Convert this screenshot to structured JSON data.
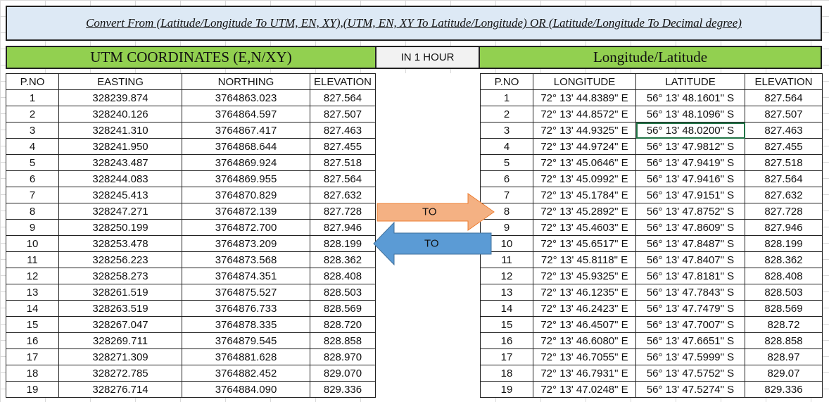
{
  "title": "Convert From (Latitude/Longitude To UTM, EN, XY),(UTM, EN, XY To Latitude/Longitude) OR (Latitude/Longitude To Decimal degree)",
  "utm_header": "UTM COORDINATES (E,N/XY)",
  "middle_label": "IN 1 HOUR",
  "geo_header": "Longitude/Latitude",
  "arrows": {
    "right_label": "TO",
    "left_label": "TO",
    "right_color": "#f4b183",
    "left_color": "#5b9bd5"
  },
  "utm_table": {
    "columns": [
      "P.NO",
      "EASTING",
      "NORTHING",
      "ELEVATION"
    ],
    "rows": [
      [
        "1",
        "328239.874",
        "3764863.023",
        "827.564"
      ],
      [
        "2",
        "328240.126",
        "3764864.597",
        "827.507"
      ],
      [
        "3",
        "328241.310",
        "3764867.417",
        "827.463"
      ],
      [
        "4",
        "328241.950",
        "3764868.644",
        "827.455"
      ],
      [
        "5",
        "328243.487",
        "3764869.924",
        "827.518"
      ],
      [
        "6",
        "328244.083",
        "3764869.955",
        "827.564"
      ],
      [
        "7",
        "328245.413",
        "3764870.829",
        "827.632"
      ],
      [
        "8",
        "328247.271",
        "3764872.139",
        "827.728"
      ],
      [
        "9",
        "328250.199",
        "3764872.700",
        "827.946"
      ],
      [
        "10",
        "328253.478",
        "3764873.209",
        "828.199"
      ],
      [
        "11",
        "328256.223",
        "3764873.568",
        "828.362"
      ],
      [
        "12",
        "328258.273",
        "3764874.351",
        "828.408"
      ],
      [
        "13",
        "328261.519",
        "3764875.527",
        "828.503"
      ],
      [
        "14",
        "328263.519",
        "3764876.733",
        "828.569"
      ],
      [
        "15",
        "328267.047",
        "3764878.335",
        "828.720"
      ],
      [
        "16",
        "328269.711",
        "3764879.545",
        "828.858"
      ],
      [
        "17",
        "328271.309",
        "3764881.628",
        "828.970"
      ],
      [
        "18",
        "328272.785",
        "3764882.452",
        "829.070"
      ],
      [
        "19",
        "328276.714",
        "3764884.090",
        "829.336"
      ]
    ]
  },
  "geo_table": {
    "columns": [
      "P.NO",
      "LONGITUDE",
      "LATITUDE",
      "ELEVATION"
    ],
    "rows": [
      [
        "1",
        "72° 13' 44.8389\" E",
        "56° 13' 48.1601\" S",
        "827.564"
      ],
      [
        "2",
        "72° 13' 44.8572\" E",
        "56° 13' 48.1096\" S",
        "827.507"
      ],
      [
        "3",
        "72° 13' 44.9325\" E",
        "56° 13' 48.0200\" S",
        "827.463"
      ],
      [
        "4",
        "72° 13' 44.9724\" E",
        "56° 13' 47.9812\" S",
        "827.455"
      ],
      [
        "5",
        "72° 13' 45.0646\" E",
        "56° 13' 47.9419\" S",
        "827.518"
      ],
      [
        "6",
        "72° 13' 45.0992\" E",
        "56° 13' 47.9416\" S",
        "827.564"
      ],
      [
        "7",
        "72° 13' 45.1784\" E",
        "56° 13' 47.9151\" S",
        "827.632"
      ],
      [
        "8",
        "72° 13' 45.2892\" E",
        "56° 13' 47.8752\" S",
        "827.728"
      ],
      [
        "9",
        "72° 13' 45.4603\" E",
        "56° 13' 47.8609\" S",
        "827.946"
      ],
      [
        "10",
        "72° 13' 45.6517\" E",
        "56° 13' 47.8487\" S",
        "828.199"
      ],
      [
        "11",
        "72° 13' 45.8118\" E",
        "56° 13' 47.8407\" S",
        "828.362"
      ],
      [
        "12",
        "72° 13' 45.9325\" E",
        "56° 13' 47.8181\" S",
        "828.408"
      ],
      [
        "13",
        "72° 13' 46.1235\" E",
        "56° 13' 47.7843\" S",
        "828.503"
      ],
      [
        "14",
        "72° 13' 46.2423\" E",
        "56° 13' 47.7479\" S",
        "828.569"
      ],
      [
        "15",
        "72° 13' 46.4507\" E",
        "56° 13' 47.7007\" S",
        "828.72"
      ],
      [
        "16",
        "72° 13' 46.6080\" E",
        "56° 13' 47.6651\" S",
        "828.858"
      ],
      [
        "17",
        "72° 13' 46.7055\" E",
        "56° 13' 47.5999\" S",
        "828.97"
      ],
      [
        "18",
        "72° 13' 46.7931\" E",
        "56° 13' 47.5752\" S",
        "829.07"
      ],
      [
        "19",
        "72° 13' 47.0248\" E",
        "56° 13' 47.5274\" S",
        "829.336"
      ]
    ]
  }
}
